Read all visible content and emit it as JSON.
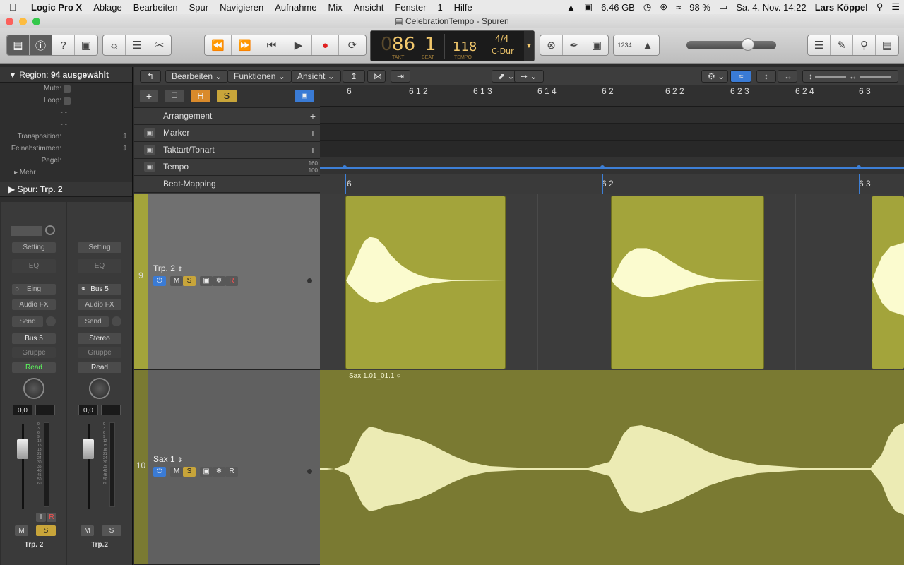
{
  "menubar": {
    "apple": "",
    "items": [
      "Logic Pro X",
      "Ablage",
      "Bearbeiten",
      "Spur",
      "Navigieren",
      "Aufnahme",
      "Mix",
      "Ansicht",
      "Fenster",
      "1",
      "Hilfe"
    ],
    "storage": "6.46 GB",
    "battery": "98 %",
    "datetime": "Sa. 4. Nov.  14:22",
    "user": "Lars Köppel"
  },
  "window": {
    "title": "CelebrationTempo - Spuren"
  },
  "lcd": {
    "bar": "86",
    "beat": "1",
    "bar_label": "TAKT",
    "beat_label": "BEAT",
    "tempo": "118",
    "tempo_label": "TEMPO",
    "signature": "4/4",
    "key": "C-Dur"
  },
  "toolbar_right": {
    "count_in": "1234"
  },
  "inspector": {
    "region_title": "Region:",
    "region_value": "94 ausgewählt",
    "rows": {
      "mute": "Mute:",
      "loop": "Loop:",
      "dash1": "- -",
      "dash2": "- -",
      "transposition": "Transposition:",
      "fine": "Feinabstimmen:",
      "level": "Pegel:"
    },
    "more": "Mehr",
    "track_title": "Spur:",
    "track_value": "Trp. 2"
  },
  "strips": [
    {
      "setting": "Setting",
      "eq": "EQ",
      "input": "Eing",
      "audiofx": "Audio FX",
      "send": "Send",
      "output": "Bus 5",
      "group": "Gruppe",
      "automation": "Read",
      "pan": "0,0",
      "name": "Trp. 2",
      "m": "M",
      "s": "S",
      "i": "I",
      "r": "R"
    },
    {
      "setting": "Setting",
      "eq": "EQ",
      "input": "Bus 5",
      "audiofx": "Audio FX",
      "send": "Send",
      "output": "Stereo",
      "group": "Gruppe",
      "automation": "Read",
      "pan": "0,0",
      "name": "Trp.2",
      "m": "M",
      "s": "S"
    }
  ],
  "meter_scale": [
    "0",
    "3",
    "6",
    "9",
    "12",
    "15",
    "18",
    "21",
    "24",
    "30",
    "35",
    "40",
    "45",
    "50",
    "60"
  ],
  "tracks_toolbar": {
    "edit": "Bearbeiten",
    "functions": "Funktionen",
    "view": "Ansicht"
  },
  "header_buttons": {
    "add": "+",
    "h": "H",
    "s": "S"
  },
  "global_tracks": [
    {
      "name": "Arrangement"
    },
    {
      "name": "Marker"
    },
    {
      "name": "Taktart/Tonart"
    },
    {
      "name": "Tempo",
      "hi": "160",
      "lo": "100"
    },
    {
      "name": "Beat-Mapping"
    }
  ],
  "ruler": [
    "6",
    "6 1 2",
    "6 1 3",
    "6 1 4",
    "6 2",
    "6 2 2",
    "6 2 3",
    "6 2 4",
    "6 3"
  ],
  "beatmap_ticks": [
    "6",
    "6 2",
    "6 3"
  ],
  "tracks": [
    {
      "number": "9",
      "name": "Trp. 2",
      "m": "M",
      "s": "S",
      "r": "R"
    },
    {
      "number": "10",
      "name": "Sax 1",
      "m": "M",
      "s": "S",
      "r": "R"
    }
  ],
  "regions": {
    "sax": "Sax 1.01_01.1"
  },
  "colors": {
    "region": "#a3a43b",
    "sax_lane": "#7a7a32",
    "accent": "#f2c86c"
  }
}
